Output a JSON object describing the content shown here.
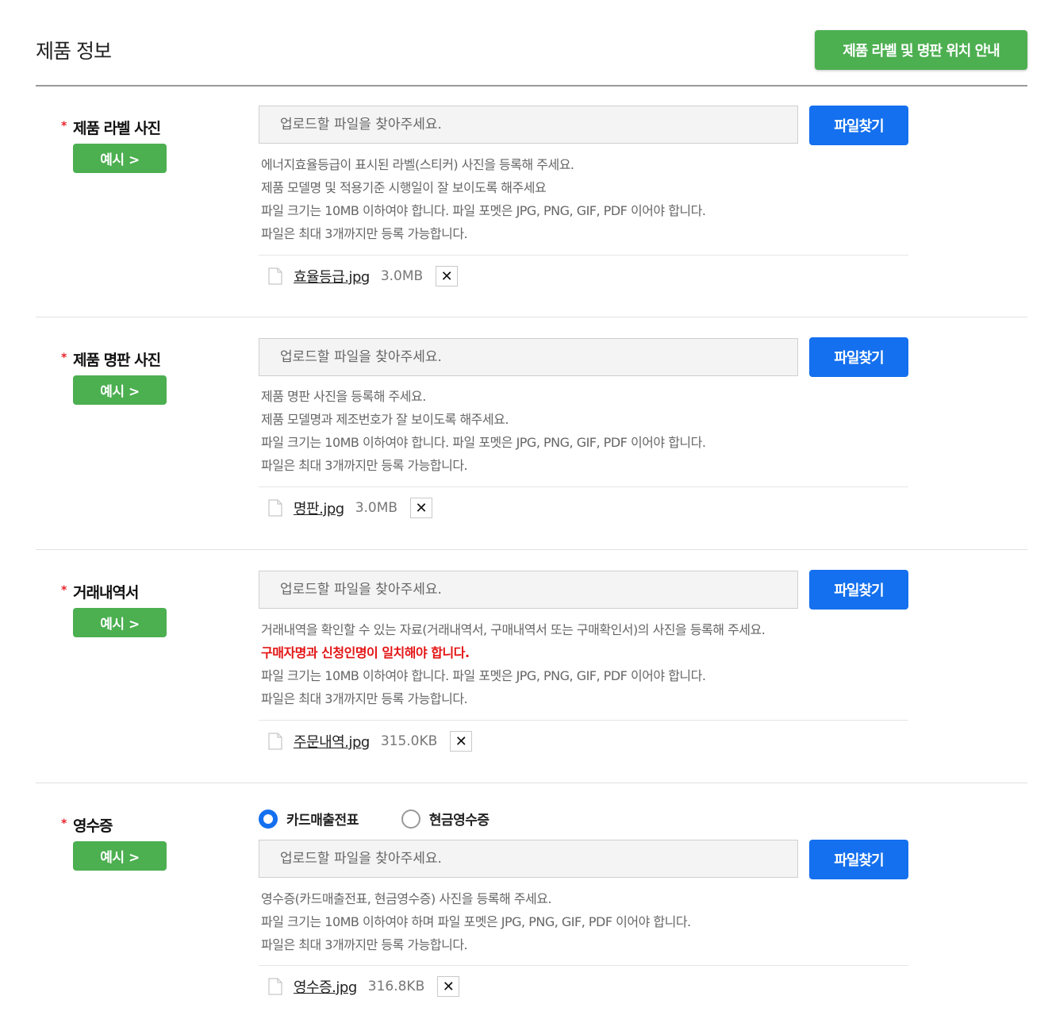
{
  "header": {
    "title": "제품 정보",
    "guide_button": "제품 라벨 및 명판 위치 안내"
  },
  "common": {
    "required_mark": "*",
    "example_button": "예시 >",
    "find_button": "파일찾기",
    "placeholder": "업로드할 파일을 찾아주세요.",
    "delete_icon": "close-icon",
    "delete_symbol": "✕"
  },
  "sections": [
    {
      "label": "제품 라벨 사진",
      "notes": [
        "에너지효율등급이 표시된 라벨(스티커) 사진을 등록해 주세요.",
        "제품 모델명 및 적용기준 시행일이 잘 보이도록 해주세요",
        "파일 크기는 10MB 이하여야 합니다. 파일 포멧은 JPG, PNG, GIF, PDF 이어야 합니다.",
        "파일은 최대 3개까지만 등록 가능합니다."
      ],
      "file": {
        "name": "효율등급.jpg",
        "size": "3.0MB"
      }
    },
    {
      "label": "제품 명판 사진",
      "notes": [
        "제품 명판 사진을 등록해 주세요.",
        "제품 모델명과 제조번호가 잘 보이도록 해주세요.",
        "파일 크기는 10MB 이하여야 합니다. 파일 포멧은 JPG, PNG, GIF, PDF 이어야 합니다.",
        "파일은 최대 3개까지만 등록 가능합니다."
      ],
      "file": {
        "name": "명판.jpg",
        "size": "3.0MB"
      }
    },
    {
      "label": "거래내역서",
      "notes": [
        "거래내역을 확인할 수 있는 자료(거래내역서, 구매내역서 또는 구매확인서)의 사진을 등록해 주세요.",
        "구매자명과 신청인명이 일치해야 합니다.",
        "파일 크기는 10MB 이하여야 합니다. 파일 포멧은 JPG, PNG, GIF, PDF 이어야 합니다.",
        "파일은 최대 3개까지만 등록 가능합니다."
      ],
      "file": {
        "name": "주문내역.jpg",
        "size": "315.0KB"
      }
    },
    {
      "label": "영수증",
      "radio": {
        "options": [
          "카드매출전표",
          "현금영수증"
        ],
        "selected": "카드매출전표"
      },
      "notes": [
        "영수증(카드매출전표, 현금영수증) 사진을 등록해 주세요.",
        "파일 크기는 10MB 이하여야 하며 파일 포멧은 JPG, PNG, GIF, PDF 이어야 합니다.",
        "파일은 최대 3개까지만 등록 가능합니다."
      ],
      "file": {
        "name": "영수증.jpg",
        "size": "316.8KB"
      }
    }
  ],
  "colors": {
    "green": "#4caf50",
    "blue": "#1470ee",
    "required": "#e8232c",
    "warning": "#e31414"
  }
}
